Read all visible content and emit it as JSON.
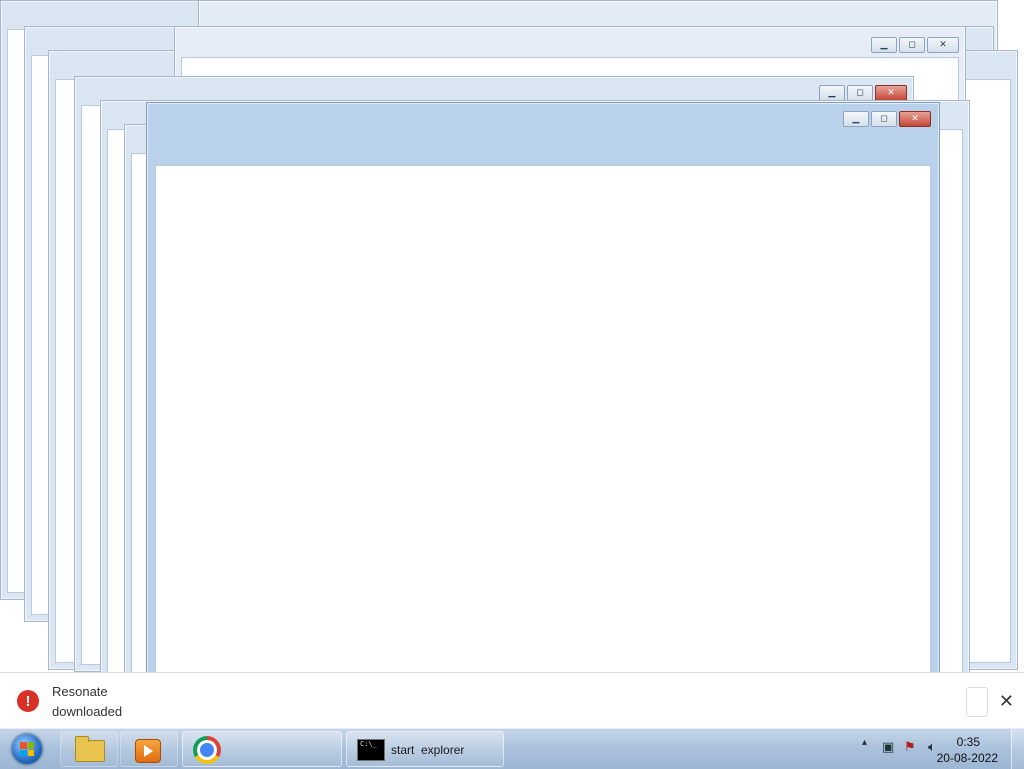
{
  "windows": [
    {
      "id": "w1",
      "minimize": "▁",
      "maximize": "◻",
      "close": "✕"
    },
    {
      "id": "w2",
      "minimize": "▁",
      "maximize": "◻",
      "close": "✕"
    },
    {
      "id": "w3",
      "minimize": "▁",
      "maximize": "◻",
      "close": "✕"
    },
    {
      "id": "w4",
      "minimize": "▁",
      "maximize": "◻",
      "close": "✕"
    }
  ],
  "download_bar": {
    "message_line1": "Resonate",
    "message_line2": "downloaded",
    "error_symbol": "!",
    "close_symbol": "✕"
  },
  "taskbar": {
    "start_label": "Start",
    "pinned": [
      "Windows Explorer",
      "Windows Media Player",
      "Google Chrome"
    ],
    "cmd_window_label": "start  explorer",
    "cmd_icon_text": "C:\\_",
    "clock_time": "0:35",
    "clock_date": "20-08-2022"
  },
  "colors": {
    "window_frame": "#dbe6f3",
    "active_title": "#b9d1ea",
    "close_red": "#c4473a",
    "taskbar": "#a9c1dc",
    "error_red": "#d93025"
  }
}
